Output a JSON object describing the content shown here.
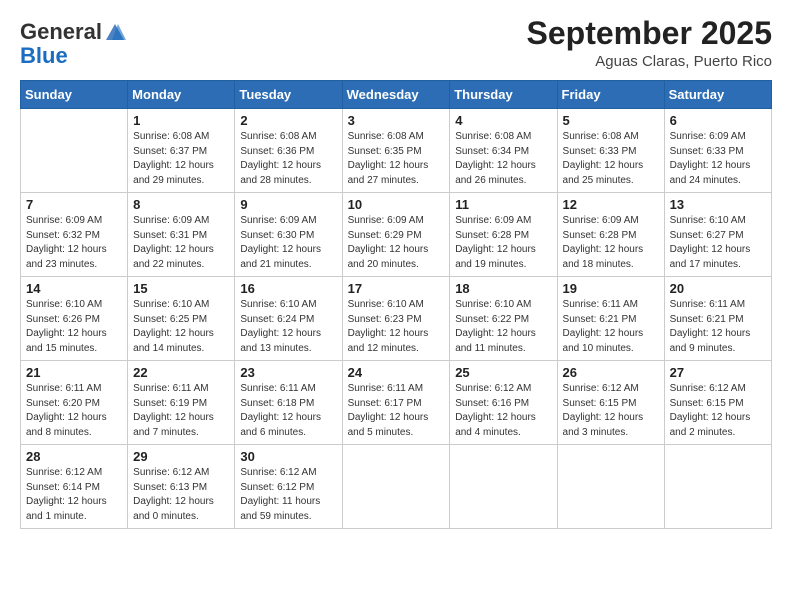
{
  "header": {
    "logo_general": "General",
    "logo_blue": "Blue",
    "month_title": "September 2025",
    "subtitle": "Aguas Claras, Puerto Rico"
  },
  "days_of_week": [
    "Sunday",
    "Monday",
    "Tuesday",
    "Wednesday",
    "Thursday",
    "Friday",
    "Saturday"
  ],
  "weeks": [
    [
      {
        "day": "",
        "info": ""
      },
      {
        "day": "1",
        "info": "Sunrise: 6:08 AM\nSunset: 6:37 PM\nDaylight: 12 hours\nand 29 minutes."
      },
      {
        "day": "2",
        "info": "Sunrise: 6:08 AM\nSunset: 6:36 PM\nDaylight: 12 hours\nand 28 minutes."
      },
      {
        "day": "3",
        "info": "Sunrise: 6:08 AM\nSunset: 6:35 PM\nDaylight: 12 hours\nand 27 minutes."
      },
      {
        "day": "4",
        "info": "Sunrise: 6:08 AM\nSunset: 6:34 PM\nDaylight: 12 hours\nand 26 minutes."
      },
      {
        "day": "5",
        "info": "Sunrise: 6:08 AM\nSunset: 6:33 PM\nDaylight: 12 hours\nand 25 minutes."
      },
      {
        "day": "6",
        "info": "Sunrise: 6:09 AM\nSunset: 6:33 PM\nDaylight: 12 hours\nand 24 minutes."
      }
    ],
    [
      {
        "day": "7",
        "info": "Sunrise: 6:09 AM\nSunset: 6:32 PM\nDaylight: 12 hours\nand 23 minutes."
      },
      {
        "day": "8",
        "info": "Sunrise: 6:09 AM\nSunset: 6:31 PM\nDaylight: 12 hours\nand 22 minutes."
      },
      {
        "day": "9",
        "info": "Sunrise: 6:09 AM\nSunset: 6:30 PM\nDaylight: 12 hours\nand 21 minutes."
      },
      {
        "day": "10",
        "info": "Sunrise: 6:09 AM\nSunset: 6:29 PM\nDaylight: 12 hours\nand 20 minutes."
      },
      {
        "day": "11",
        "info": "Sunrise: 6:09 AM\nSunset: 6:28 PM\nDaylight: 12 hours\nand 19 minutes."
      },
      {
        "day": "12",
        "info": "Sunrise: 6:09 AM\nSunset: 6:28 PM\nDaylight: 12 hours\nand 18 minutes."
      },
      {
        "day": "13",
        "info": "Sunrise: 6:10 AM\nSunset: 6:27 PM\nDaylight: 12 hours\nand 17 minutes."
      }
    ],
    [
      {
        "day": "14",
        "info": "Sunrise: 6:10 AM\nSunset: 6:26 PM\nDaylight: 12 hours\nand 15 minutes."
      },
      {
        "day": "15",
        "info": "Sunrise: 6:10 AM\nSunset: 6:25 PM\nDaylight: 12 hours\nand 14 minutes."
      },
      {
        "day": "16",
        "info": "Sunrise: 6:10 AM\nSunset: 6:24 PM\nDaylight: 12 hours\nand 13 minutes."
      },
      {
        "day": "17",
        "info": "Sunrise: 6:10 AM\nSunset: 6:23 PM\nDaylight: 12 hours\nand 12 minutes."
      },
      {
        "day": "18",
        "info": "Sunrise: 6:10 AM\nSunset: 6:22 PM\nDaylight: 12 hours\nand 11 minutes."
      },
      {
        "day": "19",
        "info": "Sunrise: 6:11 AM\nSunset: 6:21 PM\nDaylight: 12 hours\nand 10 minutes."
      },
      {
        "day": "20",
        "info": "Sunrise: 6:11 AM\nSunset: 6:21 PM\nDaylight: 12 hours\nand 9 minutes."
      }
    ],
    [
      {
        "day": "21",
        "info": "Sunrise: 6:11 AM\nSunset: 6:20 PM\nDaylight: 12 hours\nand 8 minutes."
      },
      {
        "day": "22",
        "info": "Sunrise: 6:11 AM\nSunset: 6:19 PM\nDaylight: 12 hours\nand 7 minutes."
      },
      {
        "day": "23",
        "info": "Sunrise: 6:11 AM\nSunset: 6:18 PM\nDaylight: 12 hours\nand 6 minutes."
      },
      {
        "day": "24",
        "info": "Sunrise: 6:11 AM\nSunset: 6:17 PM\nDaylight: 12 hours\nand 5 minutes."
      },
      {
        "day": "25",
        "info": "Sunrise: 6:12 AM\nSunset: 6:16 PM\nDaylight: 12 hours\nand 4 minutes."
      },
      {
        "day": "26",
        "info": "Sunrise: 6:12 AM\nSunset: 6:15 PM\nDaylight: 12 hours\nand 3 minutes."
      },
      {
        "day": "27",
        "info": "Sunrise: 6:12 AM\nSunset: 6:15 PM\nDaylight: 12 hours\nand 2 minutes."
      }
    ],
    [
      {
        "day": "28",
        "info": "Sunrise: 6:12 AM\nSunset: 6:14 PM\nDaylight: 12 hours\nand 1 minute."
      },
      {
        "day": "29",
        "info": "Sunrise: 6:12 AM\nSunset: 6:13 PM\nDaylight: 12 hours\nand 0 minutes."
      },
      {
        "day": "30",
        "info": "Sunrise: 6:12 AM\nSunset: 6:12 PM\nDaylight: 11 hours\nand 59 minutes."
      },
      {
        "day": "",
        "info": ""
      },
      {
        "day": "",
        "info": ""
      },
      {
        "day": "",
        "info": ""
      },
      {
        "day": "",
        "info": ""
      }
    ]
  ]
}
